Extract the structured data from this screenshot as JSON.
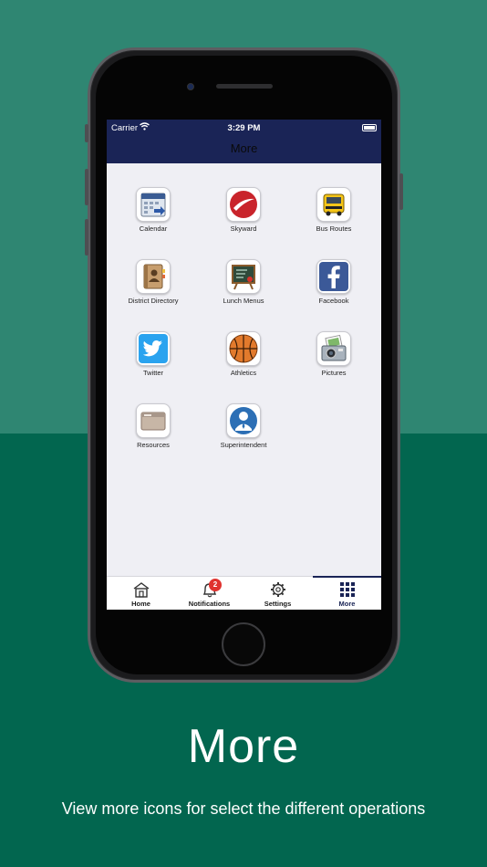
{
  "status_bar": {
    "carrier": "Carrier",
    "time": "3:29 PM"
  },
  "nav": {
    "title": "More"
  },
  "tiles": [
    {
      "label": "Calendar",
      "icon": "calendar-icon"
    },
    {
      "label": "Skyward",
      "icon": "skyward-icon"
    },
    {
      "label": "Bus Routes",
      "icon": "school-bus-icon"
    },
    {
      "label": "District Directory",
      "icon": "directory-book-icon"
    },
    {
      "label": "Lunch Menus",
      "icon": "chalkboard-menu-icon"
    },
    {
      "label": "Facebook",
      "icon": "facebook-icon"
    },
    {
      "label": "Twitter",
      "icon": "twitter-icon"
    },
    {
      "label": "Athletics",
      "icon": "basketball-icon"
    },
    {
      "label": "Pictures",
      "icon": "camera-photos-icon"
    },
    {
      "label": "Resources",
      "icon": "folder-icon"
    },
    {
      "label": "Superintendent",
      "icon": "person-icon"
    }
  ],
  "tabbar": {
    "home": "Home",
    "notifications": "Notifications",
    "notifications_badge": "2",
    "settings": "Settings",
    "more": "More"
  },
  "caption": {
    "title": "More",
    "subtitle": "View more icons for select the different operations"
  },
  "colors": {
    "nav": "#1a2456",
    "bg_top": "#2f8672",
    "bg_bottom": "#02664f",
    "badge": "#e0322f"
  }
}
